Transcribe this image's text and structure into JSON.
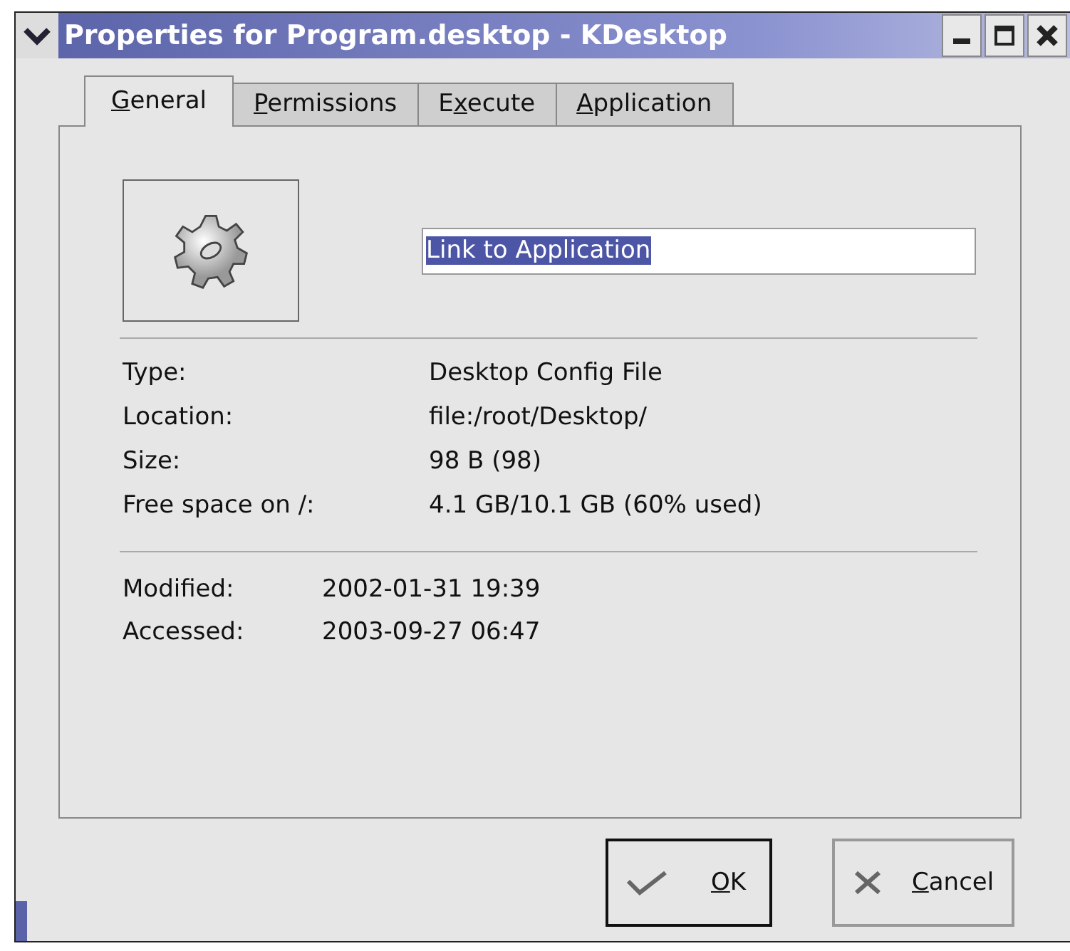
{
  "window": {
    "title": "Properties for Program.desktop - KDesktop"
  },
  "tabs": [
    {
      "key": "G",
      "post": "eneral",
      "selected": true
    },
    {
      "key": "P",
      "post": "ermissions",
      "selected": false
    },
    {
      "pre": "E",
      "key": "x",
      "post": "ecute",
      "selected": false
    },
    {
      "key": "A",
      "post": "pplication",
      "selected": false
    }
  ],
  "name_field": {
    "value": "Link to Application",
    "selected": true
  },
  "info": [
    {
      "label": "Type:",
      "value": "Desktop Config File"
    },
    {
      "label": "Location:",
      "value": "file:/root/Desktop/"
    },
    {
      "label": "Size:",
      "value": "98 B (98)"
    },
    {
      "label": "Free space on /:",
      "value": "4.1 GB/10.1 GB (60% used)"
    }
  ],
  "times": [
    {
      "label": "Modified:",
      "value": "2002-01-31 19:39"
    },
    {
      "label": "Accessed:",
      "value": "2003-09-27 06:47"
    }
  ],
  "buttons": [
    {
      "kind": "ok",
      "key": "O",
      "post": "K",
      "default": true
    },
    {
      "kind": "cancel",
      "key": "C",
      "post": "ancel",
      "default": false
    }
  ]
}
